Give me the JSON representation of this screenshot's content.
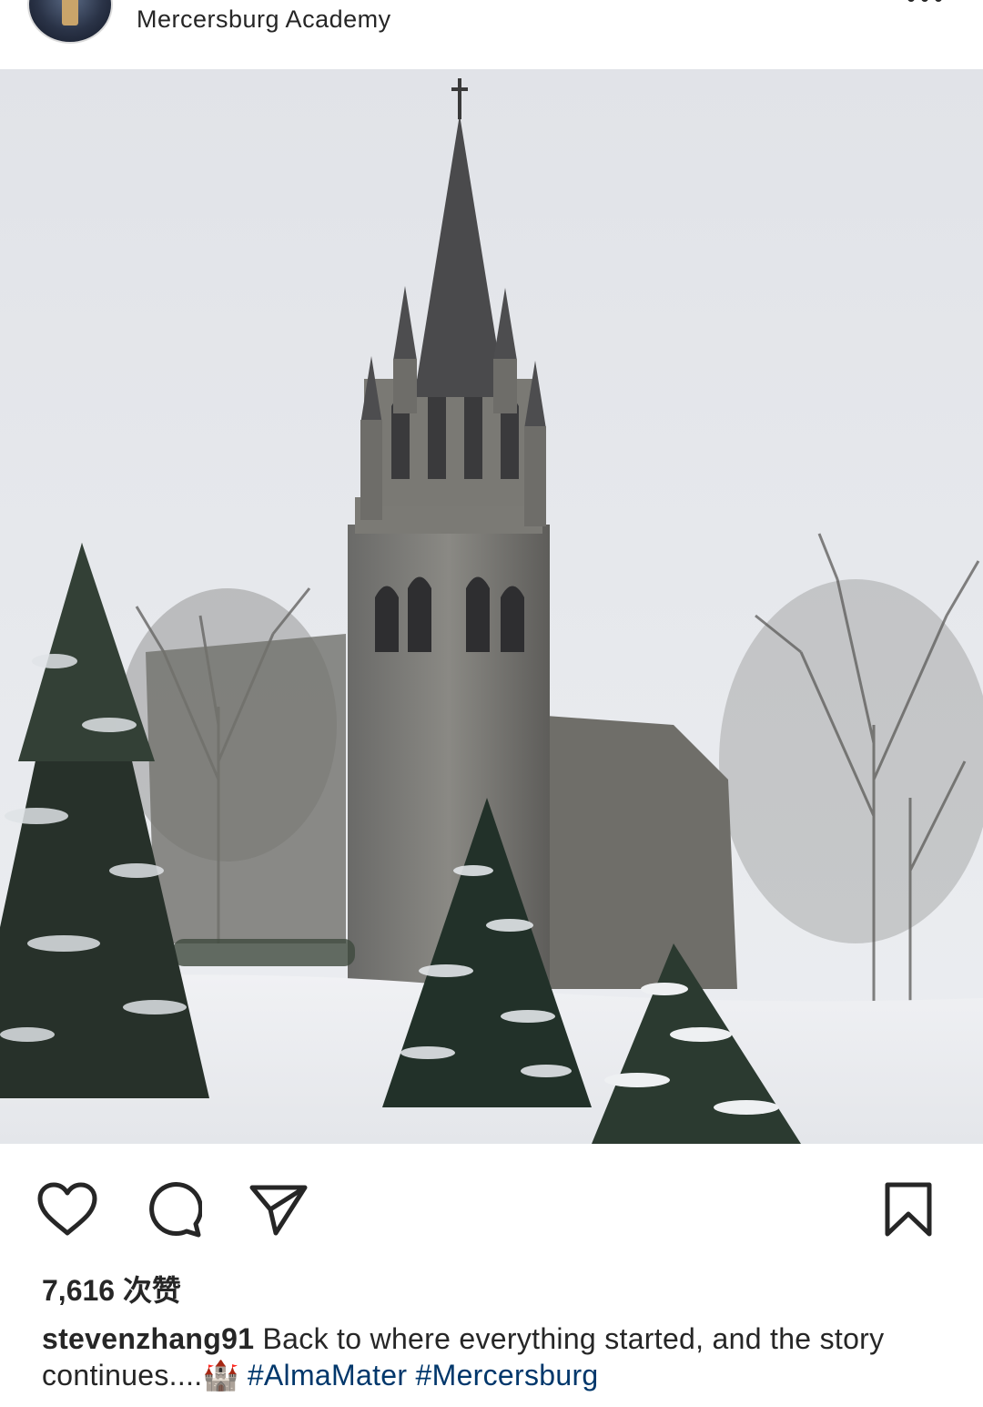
{
  "post": {
    "location": "Mercersburg Academy",
    "photo_alt": "",
    "likes_label": "7,616 次赞",
    "caption": {
      "username": "stevenzhang91",
      "text": "Back to where everything started, and the story continues....",
      "emoji": "🏰",
      "hashtags": [
        "#AlmaMater",
        "#Mercersburg"
      ]
    }
  },
  "icons": {
    "more": "more-options-icon",
    "like": "heart-icon",
    "comment": "comment-icon",
    "share": "paper-plane-icon",
    "save": "bookmark-icon"
  },
  "colors": {
    "text": "#262626",
    "hashtag": "#00376b",
    "sky": "#e5e6ea",
    "snow": "#f3f4f7"
  }
}
